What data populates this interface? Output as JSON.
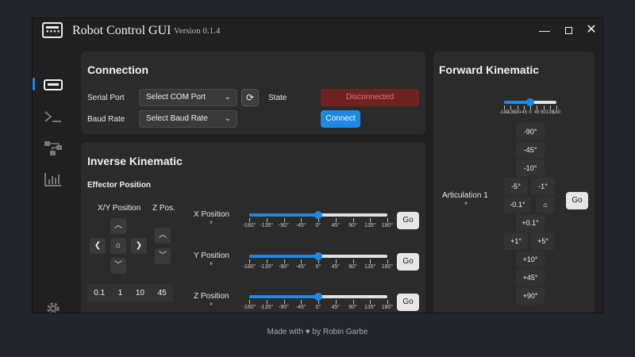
{
  "window": {
    "title": "Robot Control GUI",
    "version": "Version 0.1.4",
    "minimize": "—",
    "close": "✕"
  },
  "sidebar": {
    "items": [
      {
        "icon": "controller-icon",
        "active": true
      },
      {
        "icon": "terminal-icon",
        "active": false
      },
      {
        "icon": "diagram-icon",
        "active": false
      },
      {
        "icon": "chart-icon",
        "active": false
      }
    ],
    "settings_icon": "gear-icon"
  },
  "connection": {
    "title": "Connection",
    "serial_port_label": "Serial Port",
    "serial_port_value": "Select COM Port",
    "baud_rate_label": "Baud Rate",
    "baud_rate_value": "Select Baud Rate",
    "state_label": "State",
    "state_value": "Disconnected",
    "connect_label": "Connect"
  },
  "inverse": {
    "title": "Inverse Kinematic",
    "effector_title": "Effector Position",
    "xy_label": "X/Y Position",
    "z_label": "Z Pos.",
    "steps": [
      "0.1",
      "1",
      "10",
      "45"
    ],
    "sliders": [
      {
        "label": "X Position",
        "unit": "°",
        "value": 0,
        "go": "Go"
      },
      {
        "label": "Y Position",
        "unit": "°",
        "value": 0,
        "go": "Go"
      },
      {
        "label": "Z Position",
        "unit": "°",
        "value": 0,
        "go": "Go"
      }
    ],
    "tick_labels": [
      "-180°",
      "-135°",
      "-90°",
      "-45°",
      "0°",
      "45°",
      "90°",
      "135°",
      "180°"
    ],
    "range": [
      -180,
      180
    ]
  },
  "forward": {
    "title": "Forward Kinematic",
    "top_slider_value": 0.5,
    "top_slider_labels": [
      "-180",
      "-135",
      "-90",
      "-45",
      "0",
      "45",
      "90",
      "135",
      "180"
    ],
    "articulation_label": "Articulation 1",
    "articulation_unit": "°",
    "buttons": {
      "m90": "-90°",
      "m45": "-45°",
      "m10": "-10°",
      "m5": "-5°",
      "m1": "-1°",
      "m01": "-0.1°",
      "p01": "+0.1°",
      "p1": "+1°",
      "p5": "+5°",
      "p10": "+10°",
      "p45": "+45°",
      "p90": "+90°"
    },
    "go": "Go"
  },
  "footer": "Made with ♥ by Robin Garbe"
}
